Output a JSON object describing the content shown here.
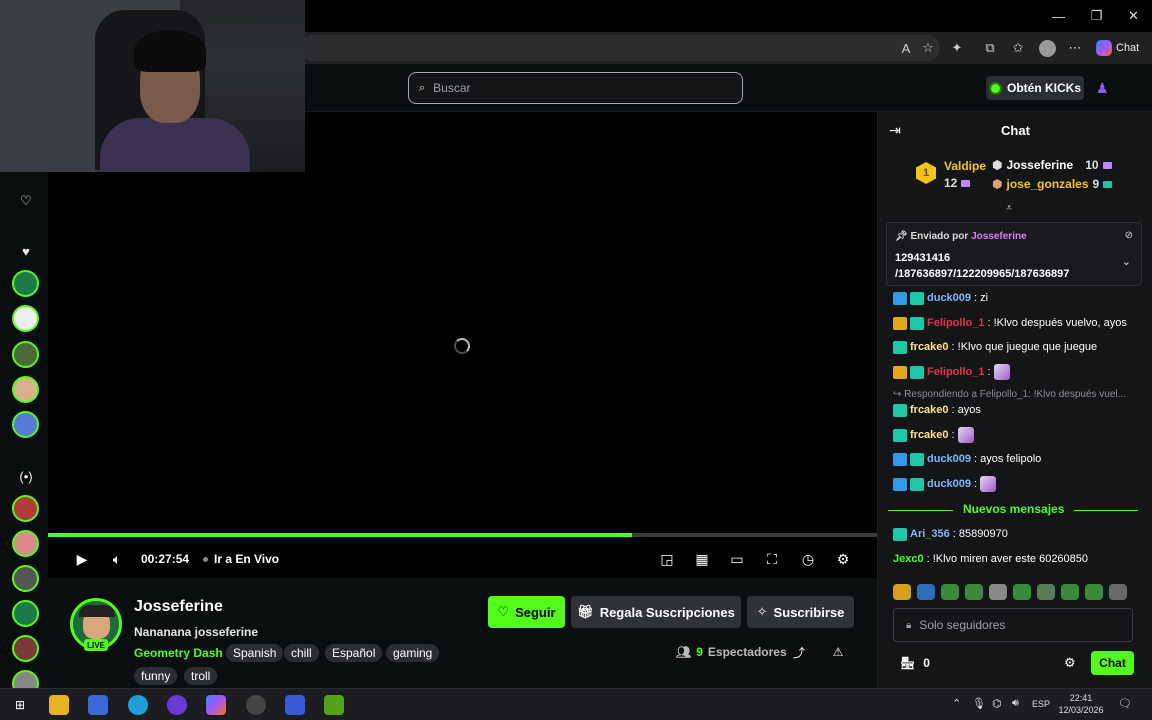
{
  "browser": {
    "copilot_label": "Chat"
  },
  "header": {
    "search_placeholder": "Buscar",
    "kicks_label": "Obtén KICKs"
  },
  "player": {
    "time": "00:27:54",
    "go_live_label": "Ir a En Vivo",
    "progress": 0.705
  },
  "channel": {
    "name": "Josseferine",
    "live_badge": "LIVE",
    "stream_title": "Nananana josseferine",
    "category": "Geometry Dash",
    "tags": [
      "Spanish",
      "chill",
      "Español",
      "gaming",
      "funny",
      "troll"
    ],
    "follow_label": "Seguir",
    "gift_label": "Regala Suscripciones",
    "subscribe_label": "Suscribirse",
    "viewer_count": "9",
    "viewers_label": "Espectadores"
  },
  "chat": {
    "title": "Chat",
    "leaderboard": {
      "first": {
        "rank": "1",
        "name": "Valdipe",
        "amount": "12"
      },
      "second": {
        "name": "Josseferine",
        "amount": "10"
      },
      "third": {
        "name": "jose_gonzales",
        "amount": "9"
      }
    },
    "pinned": {
      "sent_by_label": "Enviado por",
      "author": "Josseferine",
      "message_line1": "129431416",
      "message_line2": "/187636897/122209965/187636897"
    },
    "messages": [
      {
        "user": "duck009",
        "text": ": zi",
        "color": "#7ab8ff"
      },
      {
        "user": "Felipollo_1",
        "text": ": !Klvo después vuelvo, ayos",
        "color": "#e0354a"
      },
      {
        "user": "frcake0",
        "text": ": !Klvo que juegue que juegue",
        "color": "#fde68a"
      },
      {
        "user": "Felipollo_1",
        "text": ":",
        "color": "#e0354a"
      },
      {
        "user": "frcake0",
        "text": ": ayos",
        "color": "#fde68a"
      },
      {
        "user": "frcake0",
        "text": ":",
        "color": "#fde68a"
      },
      {
        "user": "duck009",
        "text": ": ayos felipolo",
        "color": "#7ab8ff"
      },
      {
        "user": "duck009",
        "text": ":",
        "color": "#7ab8ff"
      },
      {
        "user": "Ari_356",
        "text": ": 85890970",
        "color": "#8ab4f8"
      },
      {
        "user": "Jexc0",
        "text": ": !Klvo miren aver este 60260850",
        "color": "#53fc18"
      }
    ],
    "reply_text": "Respondiendo a Felipollo_1: !Klvo después vuel...",
    "new_messages_label": "Nuevos mensajes",
    "input_placeholder": "Solo seguidores",
    "points": "0",
    "send_label": "Chat"
  },
  "taskbar": {
    "language": "ESP",
    "time": "22:41",
    "date": "12/03/2026"
  },
  "colors": {
    "accent": "#53fc18",
    "panel": "#141517",
    "background": "#0b0e0f"
  }
}
